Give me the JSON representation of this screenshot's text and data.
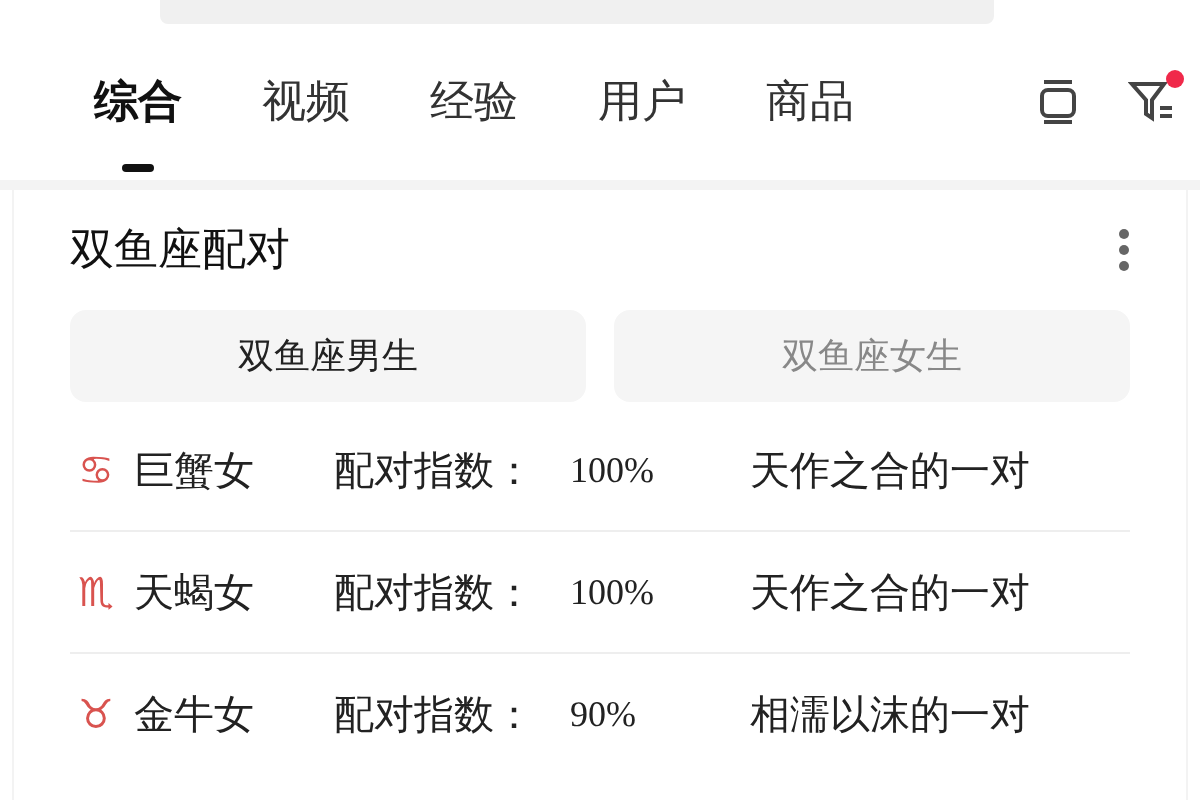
{
  "tabs": [
    {
      "label": "综合",
      "selected": true
    },
    {
      "label": "视频",
      "selected": false
    },
    {
      "label": "经验",
      "selected": false
    },
    {
      "label": "用户",
      "selected": false
    },
    {
      "label": "商品",
      "selected": false
    }
  ],
  "filter": {
    "has_notification": true
  },
  "card": {
    "title": "双鱼座配对",
    "toggle": [
      {
        "label": "双鱼座男生",
        "selected": true
      },
      {
        "label": "双鱼座女生",
        "selected": false
      }
    ],
    "rows": [
      {
        "symbol": "♋",
        "name": "巨蟹女",
        "label": "配对指数：",
        "value": "100%",
        "description": "天作之合的一对"
      },
      {
        "symbol": "♏",
        "name": "天蝎女",
        "label": "配对指数：",
        "value": "100%",
        "description": "天作之合的一对"
      },
      {
        "symbol": "♉",
        "name": "金牛女",
        "label": "配对指数：",
        "value": "90%",
        "description": "相濡以沫的一对"
      }
    ]
  }
}
